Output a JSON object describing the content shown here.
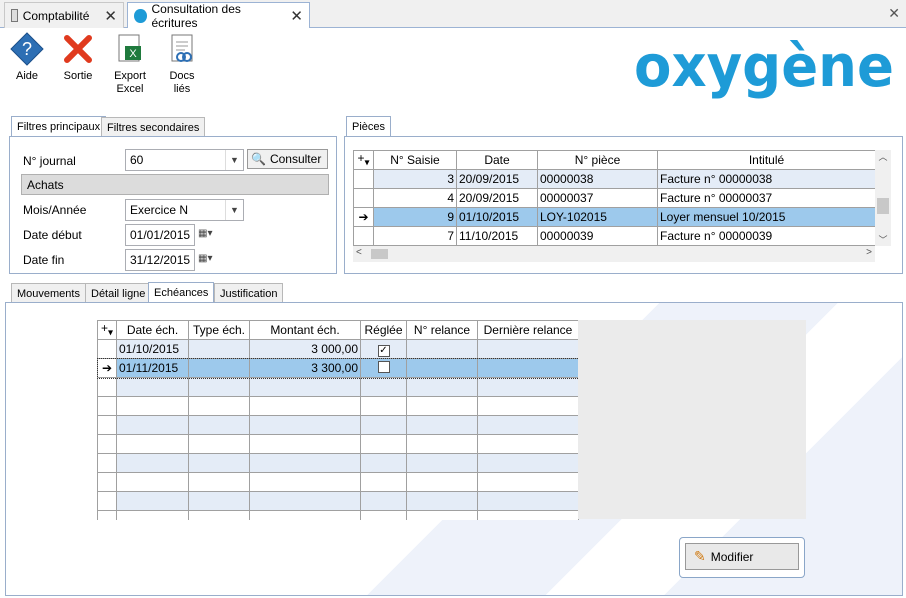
{
  "tabs": [
    {
      "label": "Comptabilité"
    },
    {
      "label": "Consultation des écritures"
    }
  ],
  "toolbar": {
    "aide": "Aide",
    "sortie": "Sortie",
    "export_l1": "Export",
    "export_l2": "Excel",
    "docs_l1": "Docs",
    "docs_l2": "liés"
  },
  "brand": {
    "logo_text": "oxygène",
    "accent": "#1e9bd7"
  },
  "filters": {
    "tab_main": "Filtres principaux",
    "tab_secondary": "Filtres secondaires",
    "journal_label": "N° journal",
    "journal_value": "60",
    "consult_label": "Consulter",
    "journal_name": "Achats",
    "period_label": "Mois/Année",
    "period_value": "Exercice N",
    "start_label": "Date début",
    "start_value": "01/01/2015",
    "end_label": "Date fin",
    "end_value": "31/12/2015"
  },
  "pieces": {
    "tab": "Pièces",
    "columns": [
      "N° Saisie",
      "Date",
      "N° pièce",
      "Intitulé"
    ],
    "rows": [
      [
        "3",
        "20/09/2015",
        "00000038",
        "Facture n° 00000038"
      ],
      [
        "4",
        "20/09/2015",
        "00000037",
        "Facture n° 00000037"
      ],
      [
        "9",
        "01/10/2015",
        "LOY-102015",
        "Loyer mensuel 10/2015"
      ],
      [
        "7",
        "11/10/2015",
        "00000039",
        "Facture n° 00000039"
      ]
    ],
    "selected_index": 2
  },
  "detail_tabs": [
    "Mouvements",
    "Détail ligne",
    "Echéances",
    "Justification"
  ],
  "echeances": {
    "columns": [
      "Date éch.",
      "Type éch.",
      "Montant éch.",
      "Réglée",
      "N° relance",
      "Dernière relance"
    ],
    "rows": [
      {
        "date": "01/10/2015",
        "type": "",
        "montant": "3 000,00",
        "reglee": true,
        "relance": "",
        "derniere": ""
      },
      {
        "date": "01/11/2015",
        "type": "",
        "montant": "3 300,00",
        "reglee": false,
        "relance": "",
        "derniere": ""
      }
    ],
    "selected_index": 1
  },
  "modify_label": "Modifier"
}
